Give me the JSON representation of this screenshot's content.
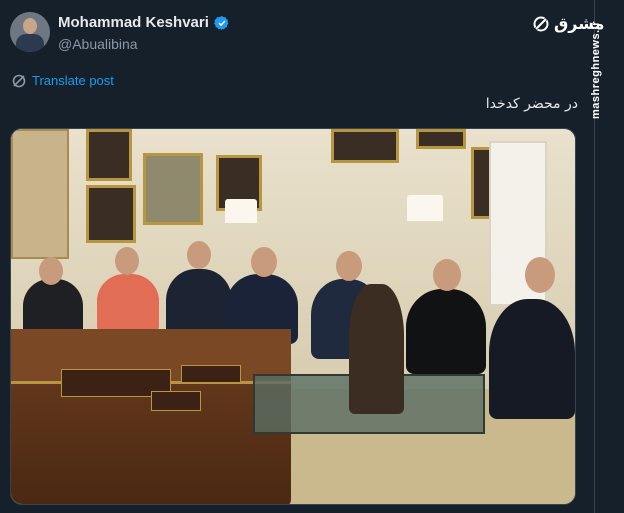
{
  "tweet": {
    "display_name": "Mohammad Keshvari",
    "handle": "@Abualibina",
    "verified_icon": "verified-badge-icon",
    "translate_label": "Translate post",
    "text": "در محضر کدخدا",
    "photo_alt": ""
  },
  "branding": {
    "logo_text": "مشرق",
    "watermark": "mashreghnews.ir"
  },
  "colors": {
    "background": "#15202b",
    "accent": "#1d9bf0",
    "text": "#e7e9ea",
    "muted": "#8b98a5"
  }
}
